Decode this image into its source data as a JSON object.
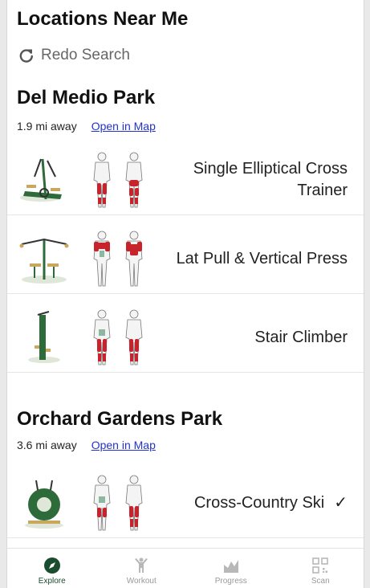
{
  "header": {
    "title": "Locations Near Me",
    "redo_label": "Redo Search"
  },
  "parks": [
    {
      "name": "Del Medio Park",
      "distance": "1.9 mi away",
      "map_link": "Open in Map",
      "equipment": [
        {
          "name": "Single Elliptical Cross Trainer",
          "checked": false
        },
        {
          "name": "Lat Pull & Vertical Press",
          "checked": false
        },
        {
          "name": "Stair Climber",
          "checked": false
        }
      ]
    },
    {
      "name": "Orchard Gardens Park",
      "distance": "3.6 mi away",
      "map_link": "Open in Map",
      "equipment": [
        {
          "name": "Cross-Country Ski",
          "checked": true,
          "check_mark": "✓"
        }
      ]
    }
  ],
  "nav": [
    {
      "label": "Explore",
      "icon": "compass-icon",
      "active": true
    },
    {
      "label": "Workout",
      "icon": "workout-icon",
      "active": false
    },
    {
      "label": "Progress",
      "icon": "progress-chart-icon",
      "active": false
    },
    {
      "label": "Scan",
      "icon": "qr-scan-icon",
      "active": false
    }
  ],
  "colors": {
    "active_nav": "#1a4d2e",
    "inactive_nav": "#b8b8b8",
    "link": "#2233cc",
    "muscle_highlight": "#c8222a",
    "equipment_green": "#2e6b3a"
  }
}
